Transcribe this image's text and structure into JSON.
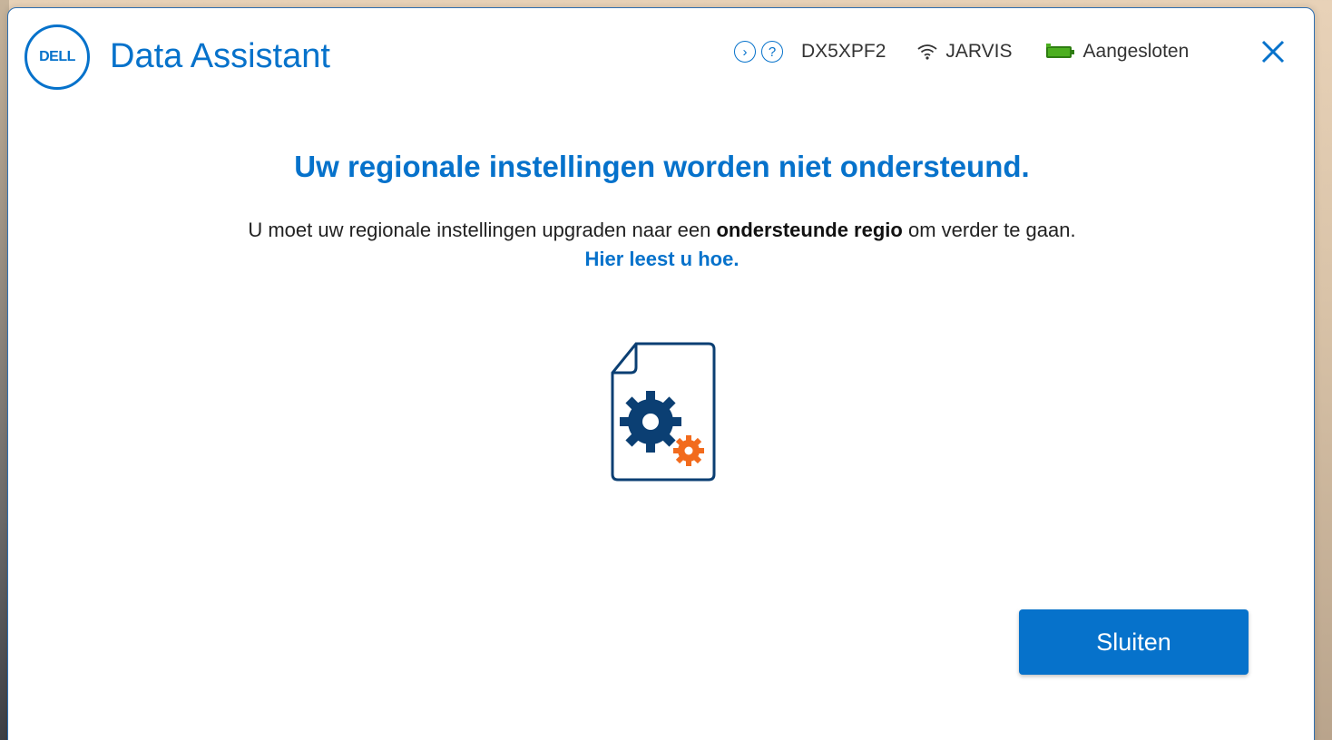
{
  "app": {
    "logo_text": "DELL",
    "title": "Data Assistant"
  },
  "status": {
    "next_icon": "chevron-right-circle-icon",
    "help_icon": "question-circle-icon",
    "service_tag": "DX5XPF2",
    "network_icon": "wifi-icon",
    "network_name": "JARVIS",
    "battery_icon": "battery-icon",
    "power_status": "Aangesloten"
  },
  "content": {
    "headline": "Uw regionale instellingen worden niet ondersteund.",
    "message_before": "U moet uw regionale instellingen upgraden naar een ",
    "message_bold": "ondersteunde regio",
    "message_after": " om verder te gaan.",
    "link": "Hier leest u hoe.",
    "illustration_icon": "settings-document-icon"
  },
  "actions": {
    "close_label": "Sluiten"
  },
  "colors": {
    "brand": "#0672cb",
    "accent_orange": "#f26b1d",
    "gear_navy": "#0b3f73",
    "battery_green": "#4caf20"
  }
}
